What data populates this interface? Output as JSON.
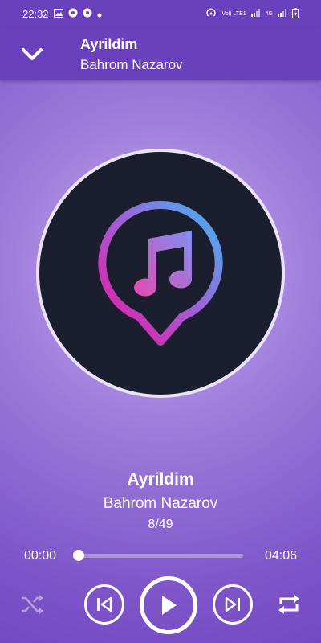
{
  "status": {
    "time": "22:32",
    "network_labels": [
      "Vol) LTE1",
      "4G"
    ]
  },
  "header": {
    "title": "Ayrildim",
    "artist": "Bahrom Nazarov"
  },
  "now_playing": {
    "title": "Ayrildim",
    "artist": "Bahrom Nazarov",
    "position": "8/49",
    "current_time": "00:00",
    "total_time": "04:06",
    "progress": 0.0
  },
  "icons": {
    "back": "chevron-down-icon",
    "shuffle": "shuffle-icon",
    "previous": "skip-previous-icon",
    "play": "play-icon",
    "next": "skip-next-icon",
    "repeat": "repeat-icon"
  },
  "colors": {
    "accent": "#6a40bd",
    "art_bg": "#1b1e2e"
  }
}
